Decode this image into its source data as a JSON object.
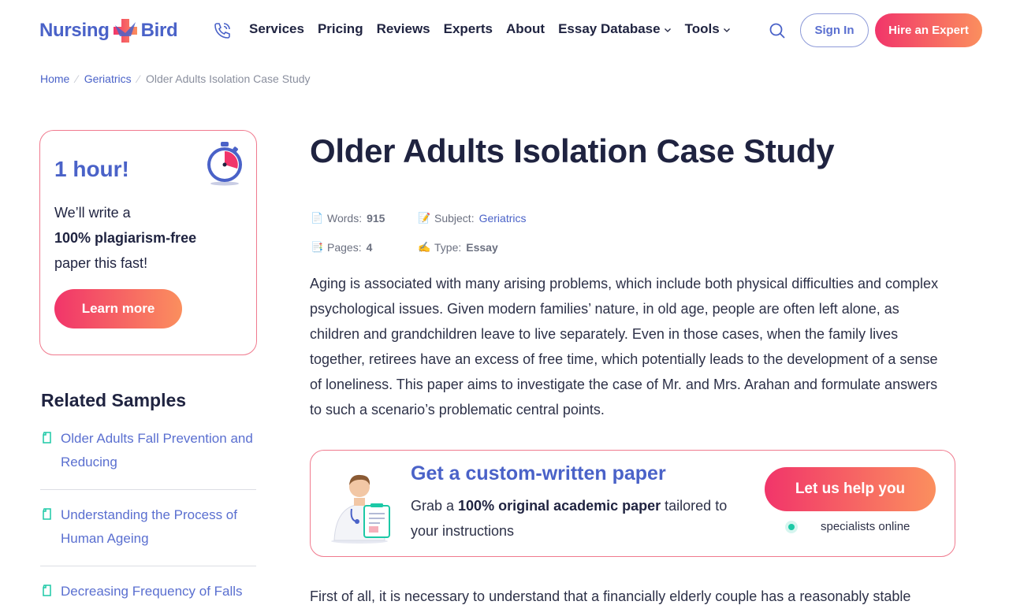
{
  "header": {
    "logo_left": "Nursing",
    "logo_right": "Bird",
    "nav": [
      "Services",
      "Pricing",
      "Reviews",
      "Experts",
      "About",
      "Essay Database",
      "Tools"
    ],
    "signin": "Sign In",
    "hire": "Hire an Expert",
    "colors": {
      "brand": "#4a62c8",
      "accent_start": "#f1356a",
      "accent_end": "#fb8f5e"
    }
  },
  "breadcrumb": {
    "home": "Home",
    "category": "Geriatrics",
    "current": "Older Adults Isolation Case Study"
  },
  "promo": {
    "title": "1 hour!",
    "line1": "We’ll write a",
    "line2_bold": "100% plagiarism-free",
    "line3": "paper this fast!",
    "button": "Learn more"
  },
  "related": {
    "title": "Related Samples",
    "items": [
      "Older Adults Fall Prevention and Reducing",
      "Understanding the Process of Human Ageing",
      "Decreasing Frequency of Falls"
    ]
  },
  "article": {
    "title": "Older Adults Isolation Case Study",
    "meta": {
      "words_label": "Words:",
      "words": "915",
      "subject_label": "Subject:",
      "subject": "Geriatrics",
      "pages_label": "Pages:",
      "pages": "4",
      "type_label": "Type:",
      "type": "Essay"
    },
    "paragraph1": "Aging is associated with many arising problems, which include both physical difficulties and complex psychological issues. Given modern families’ nature, in old age, people are often left alone, as children and grandchildren leave to live separately. Even in those cases, when the family lives together, retirees have an excess of free time, which potentially leads to the development of a sense of loneliness. This paper aims to investigate the case of Mr. and Mrs. Arahan and formulate answers to such a scenario’s problematic central points.",
    "paragraph2": "First of all, it is necessary to understand that a financially elderly couple has a reasonably stable"
  },
  "cta": {
    "title": "Get a custom-written paper",
    "text_pre": "Grab a ",
    "text_bold": "100% original academic paper",
    "text_post": " tailored to your instructions",
    "button": "Let us help you",
    "online": "specialists online"
  }
}
